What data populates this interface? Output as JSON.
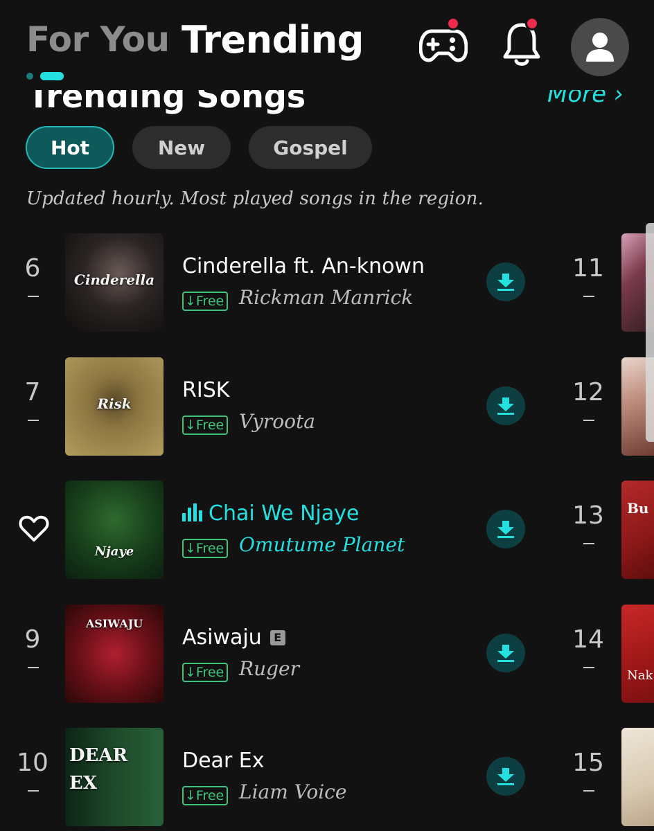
{
  "header": {
    "tab_for_you": "For You",
    "tab_trending": "Trending",
    "game_icon": "gamepad-icon",
    "bell_icon": "bell-icon",
    "avatar_icon": "user-avatar-icon"
  },
  "section": {
    "title": "Trending Songs",
    "more": "More ›",
    "chips": [
      "Hot",
      "New",
      "Gospel"
    ],
    "subtitle": "Updated hourly. Most played songs in the region."
  },
  "songs": [
    {
      "rank": "6",
      "title": "Cinderella ft. An-known",
      "badge": "↓Free",
      "artist": "Rickman Manrick",
      "cover_text": "Cinderella",
      "playing": false,
      "explicit": false
    },
    {
      "rank": "7",
      "title": "RISK",
      "badge": "↓Free",
      "artist": "Vyroota",
      "cover_text": "Risk",
      "playing": false,
      "explicit": false
    },
    {
      "rank": "",
      "title": "Chai We Njaye",
      "badge": "↓Free",
      "artist": "Omutume Planet",
      "cover_text": "Njaye",
      "playing": true,
      "explicit": false
    },
    {
      "rank": "9",
      "title": "Asiwaju",
      "badge": "↓Free",
      "artist": "Ruger",
      "cover_text": "ASIWAJU",
      "playing": false,
      "explicit": true,
      "explicit_label": "E"
    },
    {
      "rank": "10",
      "title": "Dear Ex",
      "badge": "↓Free",
      "artist": "Liam Voice",
      "cover_text": "DEAR EX",
      "playing": false,
      "explicit": false
    }
  ],
  "second_column": [
    {
      "rank": "11",
      "cover_text": ""
    },
    {
      "rank": "12",
      "cover_text": ""
    },
    {
      "rank": "13",
      "cover_text": "Bu"
    },
    {
      "rank": "14",
      "cover_text": "Nak"
    },
    {
      "rank": "15",
      "cover_text": ""
    }
  ],
  "colors": {
    "accent": "#25e0e0",
    "free_badge": "#3fc37a",
    "notification": "#ef2b4c",
    "background": "#121212"
  }
}
